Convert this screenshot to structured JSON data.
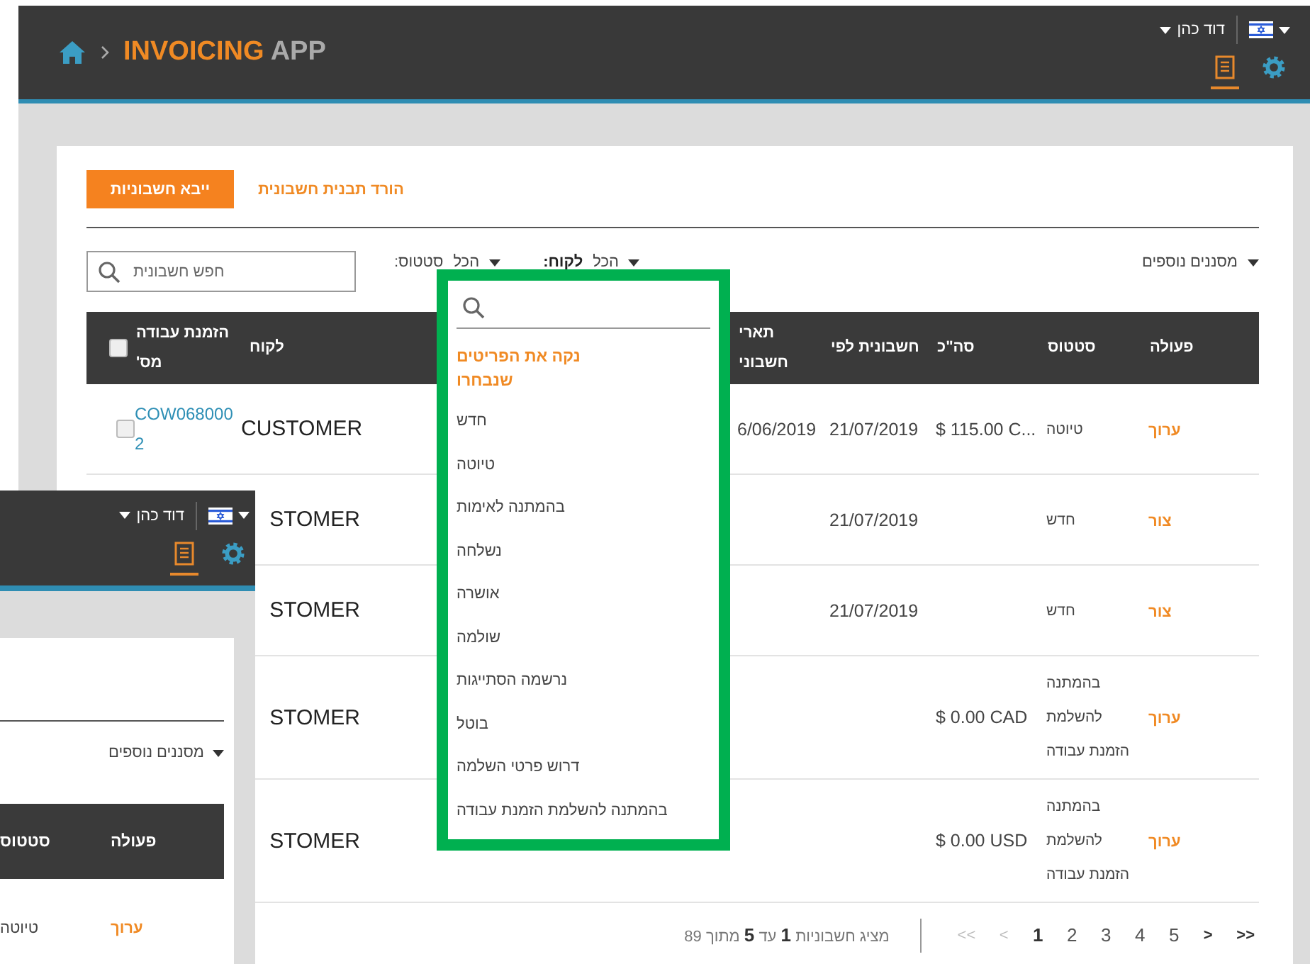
{
  "header": {
    "app_title": {
      "highlight": "INVOICING",
      "rest": "APP"
    },
    "user_name": "דוד כהן",
    "nav_icons": [
      {
        "kind": "document",
        "selected": true
      },
      {
        "kind": "settings",
        "selected": false
      }
    ]
  },
  "toolbar": {
    "import_button": "ייבא חשבוניות",
    "template_link": "הורד תבנית חשבונית"
  },
  "filters": {
    "search": {
      "placeholder": "חפש חשבונית"
    },
    "dropdowns": [
      {
        "label": "לקוח:",
        "value": "הכל",
        "active": true
      },
      {
        "label": "סטטוס:",
        "value": "הכל",
        "active": false
      }
    ],
    "more_filters": "מסננים נוספים"
  },
  "table": {
    "select_all": {
      "checked": false
    },
    "columns": {
      "order_no": "הזמנת עבודה מס'",
      "customer": "לקוח",
      "invoice_date": "תארי חשבוני",
      "invoice_by": "חשבונית לפי",
      "total": "סה\"כ",
      "status": "סטטוס",
      "action": "פעולה"
    },
    "rows": [
      {
        "checked": false,
        "order_no": "COW0680002",
        "customer": "CUSTOMER",
        "invoice_date": "6/06/2019",
        "invoice_by": "21/07/2019",
        "total": "$ 115.00 C...",
        "status": "טיוטה",
        "action": "ערוך"
      },
      {
        "customer": "STOMER",
        "invoice_by": "21/07/2019",
        "status": "חדש",
        "action": "צור"
      },
      {
        "customer": "STOMER",
        "invoice_by": "21/07/2019",
        "status": "חדש",
        "action": "צור"
      },
      {
        "customer": "STOMER",
        "total": "$ 0.00 CAD",
        "status": "בהמתנה להשלמת הזמנת עבודה",
        "action": "ערוך"
      },
      {
        "customer": "STOMER",
        "total": "$ 0.00 USD",
        "status": "בהמתנה להשלמת הזמנת עבודה",
        "action": "ערוך"
      }
    ]
  },
  "pagination": {
    "forward": [
      {
        "label": ">>",
        "disabled": false
      },
      {
        "label": ">",
        "disabled": false
      }
    ],
    "pages": [
      {
        "label": "5",
        "selected": false
      },
      {
        "label": "4",
        "selected": false
      },
      {
        "label": "3",
        "selected": false
      },
      {
        "label": "2",
        "selected": false
      },
      {
        "label": "1",
        "selected": true
      }
    ],
    "back": [
      {
        "label": "<",
        "disabled": true
      },
      {
        "label": "<<",
        "disabled": true
      }
    ],
    "summary": "מציג חשבוניות **1** עד **5** מתוך 89"
  },
  "dropdown": {
    "clear_label": "נקה את הפריטים שנבחרו",
    "options": [
      "חדש",
      "טיוטה",
      "בהמתנה לאימות",
      "נשלחה",
      "אושרה",
      "שולמה",
      "נרשמה הסתייגות",
      "בוטל",
      "דרוש פרטי השלמה",
      "בהמתנה להשלמת הזמנת עבודה"
    ]
  },
  "inset_window": {
    "user_name": "דוד כהן",
    "nav_icons": [
      {
        "kind": "document",
        "selected": true
      },
      {
        "kind": "settings",
        "selected": false
      }
    ],
    "more_filters": "מסננים נוספים",
    "columns": {
      "status": "סטטוס",
      "action": "פעולה"
    },
    "row": {
      "status": "טיוטה",
      "action": "ערוך"
    }
  }
}
